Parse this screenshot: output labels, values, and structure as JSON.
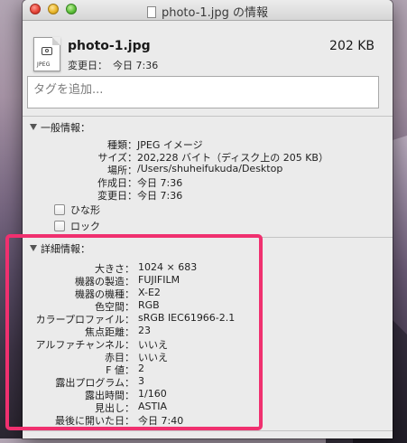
{
  "window": {
    "title": "photo-1.jpg の情報"
  },
  "header": {
    "file_name": "photo-1.jpg",
    "file_size": "202 KB",
    "modified_label": "変更日：",
    "modified_value": "今日 7:36",
    "icon_badge": "JPEG"
  },
  "tags": {
    "placeholder": "タグを追加..."
  },
  "general": {
    "heading": "一般情報：",
    "rows": [
      {
        "key": "種類：",
        "value": "JPEG イメージ"
      },
      {
        "key": "サイズ：",
        "value": "202,228 バイト（ディスク上の 205 KB）"
      },
      {
        "key": "場所：",
        "value": "/Users/shuheifukuda/Desktop"
      },
      {
        "key": "作成日：",
        "value": "今日 7:36"
      },
      {
        "key": "変更日：",
        "value": "今日 7:36"
      }
    ],
    "stationery_label": "ひな形",
    "locked_label": "ロック"
  },
  "details": {
    "heading": "詳細情報：",
    "rows": [
      {
        "key": "大きさ：",
        "value": "1024 × 683"
      },
      {
        "key": "機器の製造：",
        "value": "FUJIFILM"
      },
      {
        "key": "機器の機種：",
        "value": "X-E2"
      },
      {
        "key": "色空間：",
        "value": "RGB"
      },
      {
        "key": "カラープロファイル：",
        "value": "sRGB IEC61966-2.1"
      },
      {
        "key": "焦点距離：",
        "value": "23"
      },
      {
        "key": "アルファチャンネル：",
        "value": "いいえ"
      },
      {
        "key": "赤目：",
        "value": "いいえ"
      },
      {
        "key": "F 値：",
        "value": "2"
      },
      {
        "key": "露出プログラム：",
        "value": "3"
      },
      {
        "key": "露出時間：",
        "value": "1/160"
      },
      {
        "key": "見出し：",
        "value": "ASTIA"
      },
      {
        "key": "最後に開いた日：",
        "value": "今日 7:40"
      }
    ]
  },
  "highlight_color": "#f0306f"
}
